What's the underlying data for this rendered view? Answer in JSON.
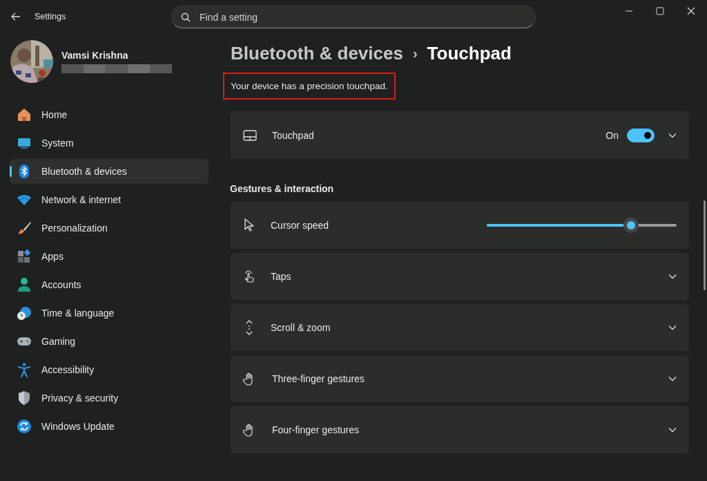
{
  "window": {
    "title": "Settings"
  },
  "search": {
    "placeholder": "Find a setting"
  },
  "profile": {
    "name": "Vamsi Krishna"
  },
  "sidebar": {
    "items": [
      {
        "label": "Home",
        "selected": false
      },
      {
        "label": "System",
        "selected": false
      },
      {
        "label": "Bluetooth & devices",
        "selected": true
      },
      {
        "label": "Network & internet",
        "selected": false
      },
      {
        "label": "Personalization",
        "selected": false
      },
      {
        "label": "Apps",
        "selected": false
      },
      {
        "label": "Accounts",
        "selected": false
      },
      {
        "label": "Time & language",
        "selected": false
      },
      {
        "label": "Gaming",
        "selected": false
      },
      {
        "label": "Accessibility",
        "selected": false
      },
      {
        "label": "Privacy & security",
        "selected": false
      },
      {
        "label": "Windows Update",
        "selected": false
      }
    ]
  },
  "breadcrumb": {
    "parent": "Bluetooth & devices",
    "separator": "›",
    "current": "Touchpad"
  },
  "notice": {
    "text": "Your device has a precision touchpad.",
    "highlighted": true
  },
  "touchpad": {
    "label": "Touchpad",
    "state_label": "On",
    "on": true
  },
  "section": {
    "title": "Gestures & interaction"
  },
  "rows": [
    {
      "kind": "slider",
      "label": "Cursor speed",
      "level": 0.76
    },
    {
      "kind": "expander",
      "label": "Taps"
    },
    {
      "kind": "expander",
      "label": "Scroll & zoom"
    },
    {
      "kind": "expander",
      "label": "Three-finger gestures"
    },
    {
      "kind": "expander",
      "label": "Four-finger gestures"
    }
  ]
}
